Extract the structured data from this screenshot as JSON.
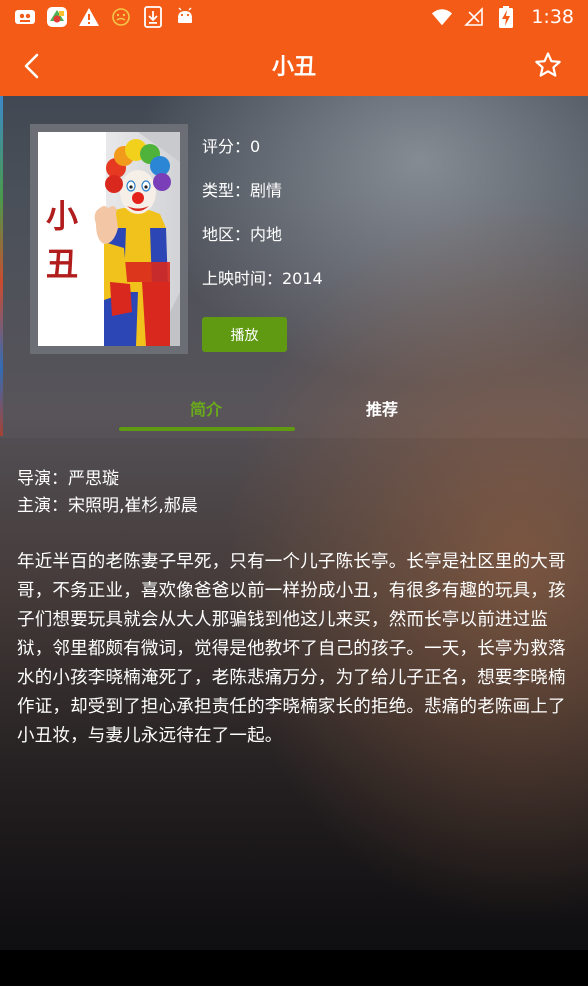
{
  "status_bar": {
    "time": "1:38",
    "left_icons": [
      "app-icon-1",
      "app-icon-2",
      "warning-icon",
      "face-icon",
      "download-icon",
      "android-icon"
    ],
    "right_icons": [
      "wifi-icon",
      "no-signal-icon",
      "battery-charging-icon"
    ]
  },
  "toolbar": {
    "title": "小丑",
    "back_icon": "chevron-left-icon",
    "favorite_icon": "star-outline-icon"
  },
  "poster": {
    "title": "小丑"
  },
  "info": {
    "rating": "评分：0",
    "genre": "类型：剧情",
    "region": "地区：内地",
    "release": "上映时间：2014"
  },
  "play_label": "播放",
  "tabs": [
    {
      "label": "简介",
      "active": true
    },
    {
      "label": "推荐",
      "active": false
    }
  ],
  "content": {
    "director": "导演：严思璇",
    "cast": "主演：宋照明,崔杉,郝晨",
    "synopsis": "年近半百的老陈妻子早死，只有一个儿子陈长亭。长亭是社区里的大哥哥，不务正业，喜欢像爸爸以前一样扮成小丑，有很多有趣的玩具，孩子们想要玩具就会从大人那骗钱到他这儿来买，然而长亭以前进过监狱，邻里都颇有微词，觉得是他教坏了自己的孩子。一天，长亭为救落水的小孩李晓楠淹死了，老陈悲痛万分，为了给儿子正名，想要李晓楠作证，却受到了担心承担责任的李晓楠家长的拒绝。悲痛的老陈画上了小丑妆，与妻儿永远待在了一起。"
  },
  "colors": {
    "accent": "#f45b17",
    "button": "#5f9a12",
    "tab_active": "#6aa81c"
  }
}
